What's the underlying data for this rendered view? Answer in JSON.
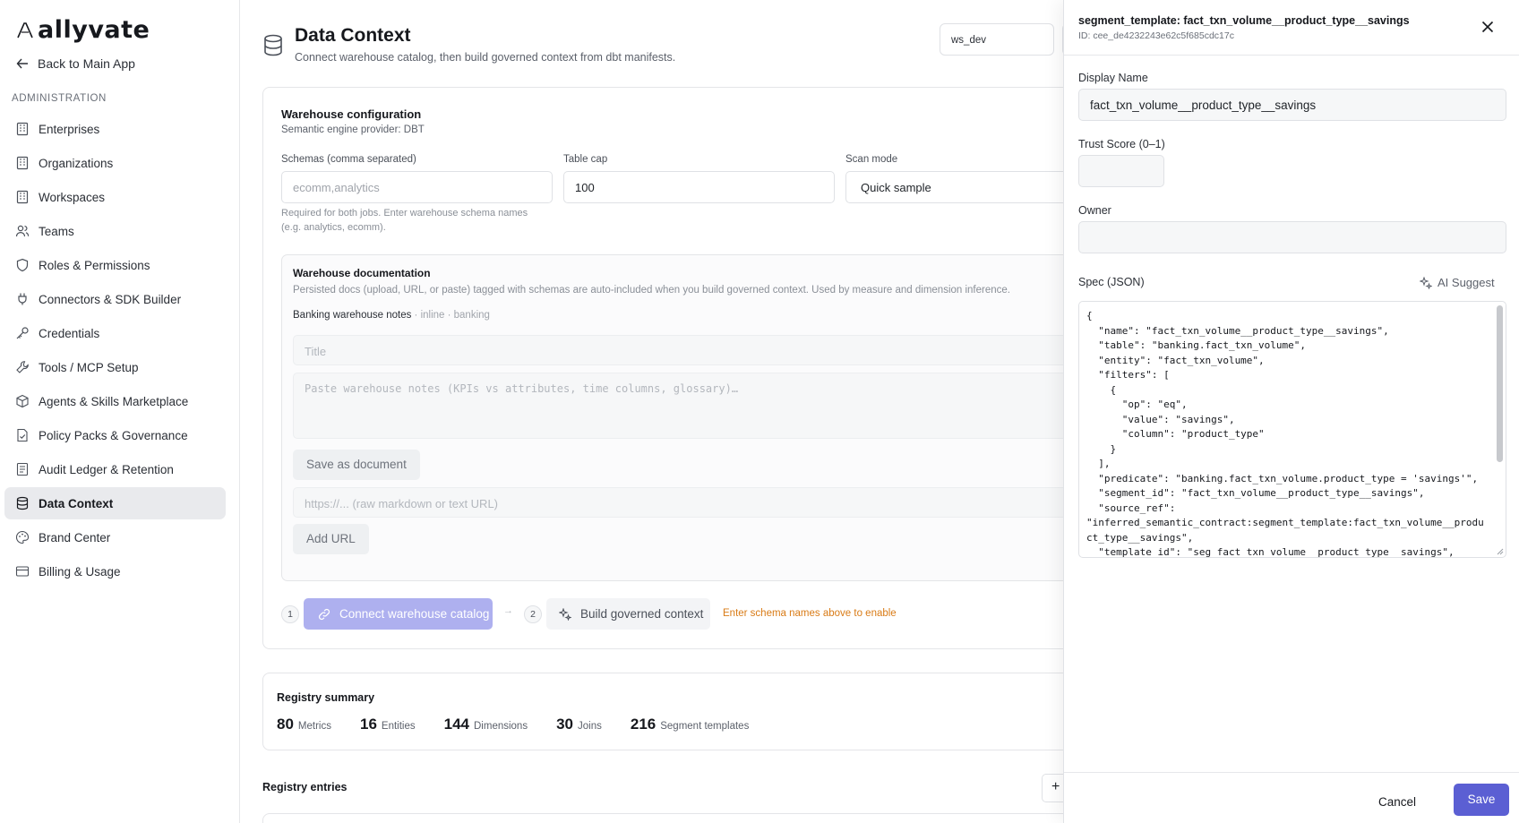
{
  "sidebar": {
    "logo_text": "allyvate",
    "back_label": "Back to Main App",
    "section_label": "ADMINISTRATION",
    "items": [
      {
        "label": "Enterprises",
        "icon": "building-icon"
      },
      {
        "label": "Organizations",
        "icon": "building-icon"
      },
      {
        "label": "Workspaces",
        "icon": "building-icon"
      },
      {
        "label": "Teams",
        "icon": "users-icon"
      },
      {
        "label": "Roles & Permissions",
        "icon": "shield-icon"
      },
      {
        "label": "Connectors & SDK Builder",
        "icon": "plug-icon"
      },
      {
        "label": "Credentials",
        "icon": "key-icon"
      },
      {
        "label": "Tools / MCP Setup",
        "icon": "wrench-icon"
      },
      {
        "label": "Agents & Skills Marketplace",
        "icon": "package-icon"
      },
      {
        "label": "Policy Packs & Governance",
        "icon": "file-check-icon"
      },
      {
        "label": "Audit Ledger & Retention",
        "icon": "ledger-icon"
      },
      {
        "label": "Data Context",
        "icon": "database-icon",
        "active": true
      },
      {
        "label": "Brand Center",
        "icon": "palette-icon"
      },
      {
        "label": "Billing & Usage",
        "icon": "credit-card-icon"
      }
    ]
  },
  "header": {
    "title": "Data Context",
    "subtitle": "Connect warehouse catalog, then build governed context from dbt manifests.",
    "workspace": "ws_dev"
  },
  "warehouse": {
    "title": "Warehouse configuration",
    "subtitle": "Semantic engine provider: DBT",
    "schemas_label": "Schemas (comma separated)",
    "schemas_placeholder": "ecomm,analytics",
    "schemas_hint": "Required for both jobs. Enter warehouse schema names (e.g. analytics, ecomm).",
    "table_cap_label": "Table cap",
    "table_cap_value": "100",
    "scan_mode_label": "Scan mode",
    "scan_mode_value": "Quick sample"
  },
  "docs": {
    "title": "Warehouse documentation",
    "subtitle": "Persisted docs (upload, URL, or paste) tagged with schemas are auto-included when you build governed context. Used by measure and dimension inference.",
    "notes_name": "Banking warehouse notes",
    "notes_meta": " · inline · banking",
    "title_placeholder": "Title",
    "notes_placeholder": "Paste warehouse notes (KPIs vs attributes, time columns, glossary)…",
    "save_label": "Save as document",
    "url_placeholder": "https://... (raw markdown or text URL)",
    "add_url_label": "Add URL"
  },
  "steps": {
    "step1": "1",
    "step2": "2",
    "connect_label": "Connect warehouse catalog",
    "build_label": "Build governed context",
    "enable_hint": "Enter schema names above to enable"
  },
  "registry": {
    "title": "Registry summary",
    "stats": [
      {
        "value": "80",
        "label": "Metrics"
      },
      {
        "value": "16",
        "label": "Entities"
      },
      {
        "value": "144",
        "label": "Dimensions"
      },
      {
        "value": "30",
        "label": "Joins"
      },
      {
        "value": "216",
        "label": "Segment templates"
      }
    ],
    "entries_title": "Registry entries",
    "add_symbol": "+"
  },
  "drawer": {
    "title": "segment_template: fact_txn_volume__product_type__savings",
    "id": "ID: cee_de4232243e62c5f685cdc17c",
    "display_name_label": "Display Name",
    "display_name_value": "fact_txn_volume__product_type__savings",
    "trust_label": "Trust Score (0–1)",
    "trust_value": "",
    "owner_label": "Owner",
    "owner_value": "",
    "spec_label": "Spec (JSON)",
    "ai_suggest_label": "AI Suggest",
    "spec_json": "{\n  \"name\": \"fact_txn_volume__product_type__savings\",\n  \"table\": \"banking.fact_txn_volume\",\n  \"entity\": \"fact_txn_volume\",\n  \"filters\": [\n    {\n      \"op\": \"eq\",\n      \"value\": \"savings\",\n      \"column\": \"product_type\"\n    }\n  ],\n  \"predicate\": \"banking.fact_txn_volume.product_type = 'savings'\",\n  \"segment_id\": \"fact_txn_volume__product_type__savings\",\n  \"source_ref\":\n\"inferred_semantic_contract:segment_template:fact_txn_volume__produ\nct_type__savings\",\n  \"template_id\": \"seg_fact_txn_volume__product_type__savings\",",
    "cancel_label": "Cancel",
    "save_label": "Save"
  },
  "colors": {
    "accent": "#5b5fd3",
    "accent_disabled": "#aeb0ef",
    "warning_text": "#d97b16"
  }
}
